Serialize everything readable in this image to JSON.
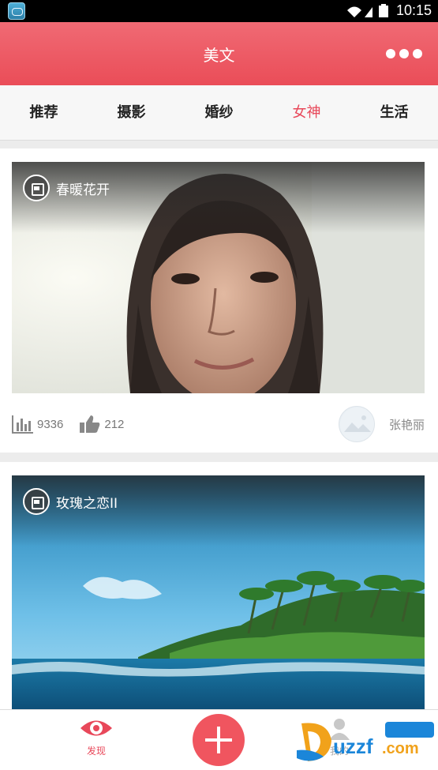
{
  "status_bar": {
    "time": "10:15"
  },
  "header": {
    "title": "美文"
  },
  "tabs": [
    {
      "label": "推荐",
      "active": false
    },
    {
      "label": "摄影",
      "active": false
    },
    {
      "label": "婚纱",
      "active": false
    },
    {
      "label": "女神",
      "active": true
    },
    {
      "label": "生活",
      "active": false
    }
  ],
  "cards": [
    {
      "title": "春暖花开",
      "views": "9336",
      "likes": "212",
      "author": "张艳丽"
    },
    {
      "title": "玫瑰之恋II"
    }
  ],
  "bottom_nav": {
    "discover_label": "发现",
    "mine_label": "我的"
  },
  "colors": {
    "accent": "#e8485a",
    "header": "#ea4d58"
  }
}
